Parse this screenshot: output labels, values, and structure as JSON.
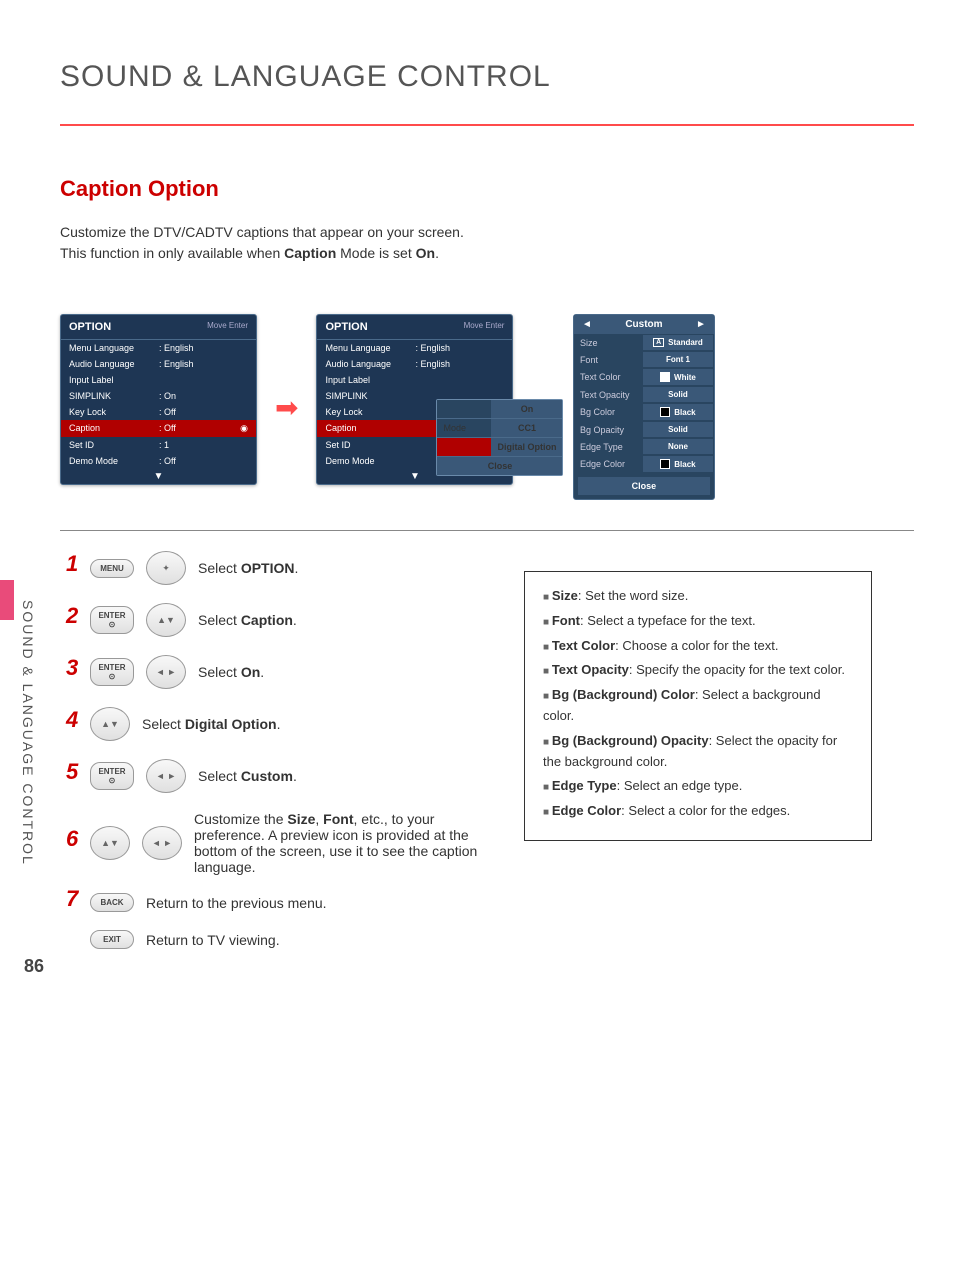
{
  "page_title": "SOUND & LANGUAGE CONTROL",
  "section_title": "Caption Option",
  "desc_line1": "Customize the DTV/CADTV captions that appear on your screen.",
  "desc_line2_pre": "This function in only available when ",
  "desc_line2_bold": "Caption",
  "desc_line2_post": " Mode is set ",
  "desc_line2_bold2": "On",
  "side_label": "SOUND & LANGUAGE CONTROL",
  "page_number": "86",
  "osd1": {
    "title": "OPTION",
    "hint": "Move    Enter",
    "rows": [
      {
        "lbl": "Menu Language",
        "val": ": English"
      },
      {
        "lbl": "Audio Language",
        "val": ": English"
      },
      {
        "lbl": "Input Label",
        "val": ""
      },
      {
        "lbl": "SIMPLINK",
        "val": ": On"
      },
      {
        "lbl": "Key Lock",
        "val": ": Off"
      },
      {
        "lbl": "Caption",
        "val": ": Off",
        "sel": true
      },
      {
        "lbl": "Set ID",
        "val": ": 1"
      },
      {
        "lbl": "Demo Mode",
        "val": ": Off"
      }
    ]
  },
  "osd2": {
    "title": "OPTION",
    "hint": "Move    Enter",
    "rows": [
      {
        "lbl": "Menu Language",
        "val": ": English"
      },
      {
        "lbl": "Audio Language",
        "val": ": English"
      },
      {
        "lbl": "Input Label",
        "val": ""
      },
      {
        "lbl": "SIMPLINK",
        "val": ""
      },
      {
        "lbl": "Key Lock",
        "val": ""
      },
      {
        "lbl": "Caption",
        "val": "",
        "sel": true
      },
      {
        "lbl": "Set ID",
        "val": ""
      },
      {
        "lbl": "Demo Mode",
        "val": ""
      }
    ],
    "popup": [
      {
        "lbl": "",
        "val": "On"
      },
      {
        "lbl": "Mode",
        "val": "CC1"
      },
      {
        "lbl": "",
        "val": "Digital Option",
        "sel": true
      },
      {
        "lbl": "",
        "val": "Close",
        "close": true
      }
    ]
  },
  "custom": {
    "title": "Custom",
    "rows": [
      {
        "lbl": "Size",
        "val": "Standard",
        "icon": "A"
      },
      {
        "lbl": "Font",
        "val": "Font 1"
      },
      {
        "lbl": "Text Color",
        "val": "White",
        "swatch": "#ffffff"
      },
      {
        "lbl": "Text Opacity",
        "val": "Solid"
      },
      {
        "lbl": "Bg Color",
        "val": "Black",
        "swatch": "#000000"
      },
      {
        "lbl": "Bg Opacity",
        "val": "Solid"
      },
      {
        "lbl": "Edge Type",
        "val": "None"
      },
      {
        "lbl": "Edge Color",
        "val": "Black",
        "swatch": "#000000"
      }
    ],
    "close": "Close"
  },
  "steps": [
    {
      "n": "1",
      "btn": "MENU",
      "nav": "updown-lr",
      "text_pre": "Select ",
      "text_b": "OPTION",
      "text_post": "."
    },
    {
      "n": "2",
      "btn": "ENTER",
      "nav": "updown",
      "text_pre": "Select ",
      "text_b": "Caption",
      "text_post": "."
    },
    {
      "n": "3",
      "btn": "ENTER",
      "nav": "lr",
      "text_pre": "Select ",
      "text_b": "On",
      "text_post": "."
    },
    {
      "n": "4",
      "btn": "",
      "nav": "updown",
      "text_pre": "Select ",
      "text_b": "Digital Option",
      "text_post": "."
    },
    {
      "n": "5",
      "btn": "ENTER",
      "nav": "lr",
      "text_pre": "Select ",
      "text_b": "Custom",
      "text_post": "."
    },
    {
      "n": "6",
      "btn": "",
      "nav": "updown",
      "nav2": "lr",
      "text_pre": "Customize the ",
      "text_b": "Size",
      "text_mid": ", ",
      "text_b2": "Font",
      "text_post": ", etc., to your preference. A preview icon is provided at the bottom of the screen, use it to see the caption language."
    },
    {
      "n": "7",
      "btn": "BACK",
      "text": "Return to the previous menu."
    },
    {
      "btn": "EXIT",
      "text": "Return to TV viewing."
    }
  ],
  "info": [
    {
      "b": "Size",
      "t": ": Set the word size."
    },
    {
      "b": "Font",
      "t": ": Select a typeface for the text."
    },
    {
      "b": "Text Color",
      "t": ": Choose a color for the text."
    },
    {
      "b": "Text Opacity",
      "t": ": Specify the opacity for the text color."
    },
    {
      "b": "Bg (Background) Color",
      "t": ": Select a background color."
    },
    {
      "b": "Bg (Background) Opacity",
      "t": ": Select the opacity for the background color."
    },
    {
      "b": "Edge Type",
      "t": ": Select an edge type."
    },
    {
      "b": "Edge Color",
      "t": ": Select a color for the edges."
    }
  ]
}
